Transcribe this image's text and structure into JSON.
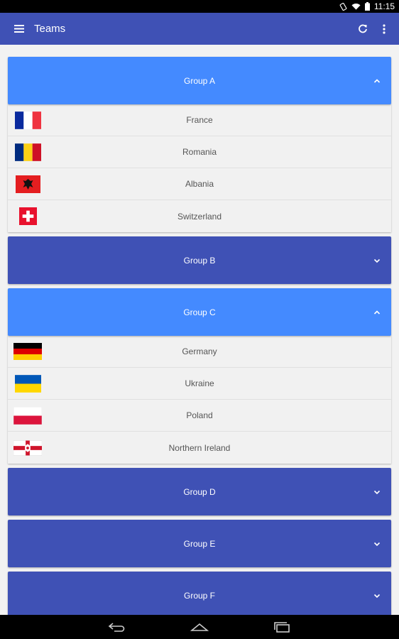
{
  "status_bar": {
    "time": "11:15"
  },
  "app_bar": {
    "title": "Teams",
    "icons": [
      "menu-icon",
      "refresh-icon",
      "more-vert-icon"
    ]
  },
  "groups": [
    {
      "label": "Group A",
      "expanded": true,
      "teams": [
        {
          "name": "France",
          "flag": "france-flag-icon"
        },
        {
          "name": "Romania",
          "flag": "romania-flag-icon"
        },
        {
          "name": "Albania",
          "flag": "albania-flag-icon"
        },
        {
          "name": "Switzerland",
          "flag": "switzerland-flag-icon"
        }
      ]
    },
    {
      "label": "Group B",
      "expanded": false
    },
    {
      "label": "Group C",
      "expanded": true,
      "teams": [
        {
          "name": "Germany",
          "flag": "germany-flag-icon"
        },
        {
          "name": "Ukraine",
          "flag": "ukraine-flag-icon"
        },
        {
          "name": "Poland",
          "flag": "poland-flag-icon"
        },
        {
          "name": "Northern Ireland",
          "flag": "northern-ireland-flag-icon"
        }
      ]
    },
    {
      "label": "Group D",
      "expanded": false
    },
    {
      "label": "Group E",
      "expanded": false
    },
    {
      "label": "Group F",
      "expanded": false
    }
  ],
  "colors": {
    "primary": "#3f51b5",
    "accent_expanded": "#448aff",
    "list_background": "#f1f1f1",
    "team_text": "#555555"
  },
  "nav_bar": {
    "icons": [
      "back-icon",
      "home-icon",
      "recents-icon"
    ]
  }
}
